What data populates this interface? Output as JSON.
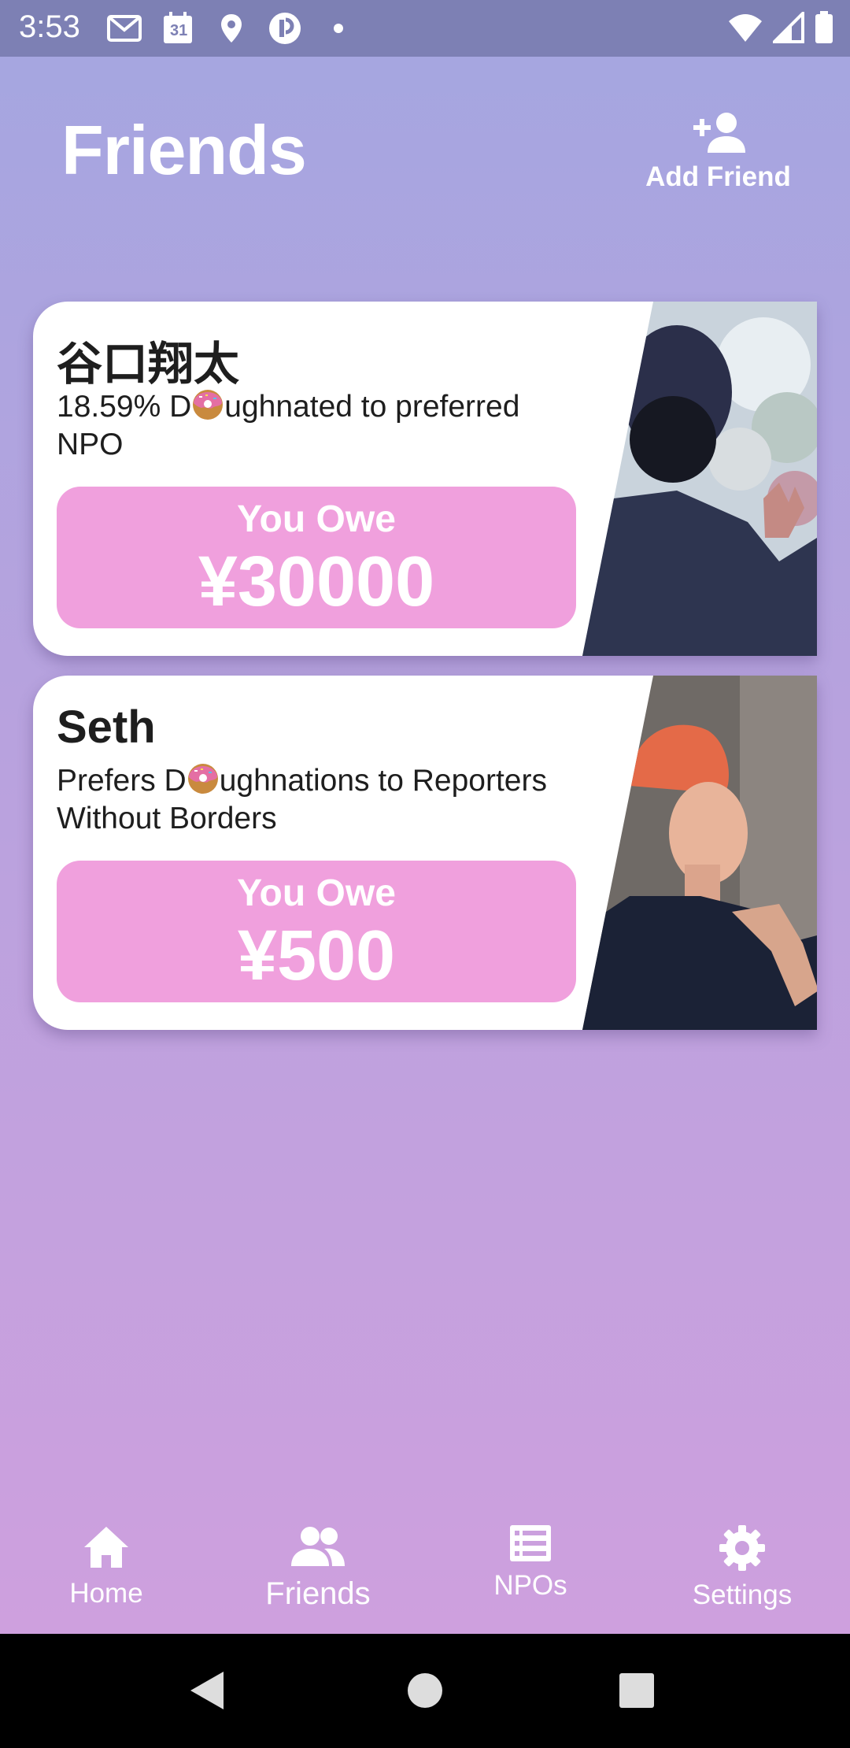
{
  "status_bar": {
    "time": "3:53",
    "calendar_day": "31",
    "left_icons": [
      "gmail-icon",
      "calendar-icon",
      "location-icon",
      "app-icon",
      "dot-icon"
    ],
    "right_icons": [
      "wifi-icon",
      "signal-icon",
      "battery-icon"
    ]
  },
  "header": {
    "title": "Friends",
    "add_friend_label": "Add Friend"
  },
  "friends": [
    {
      "name": "谷口翔太",
      "desc_before": "18.59% D",
      "desc_after": "ughnated to preferred NPO",
      "owe_label": "You Owe",
      "owe_amount": "¥30000"
    },
    {
      "name": "Seth",
      "desc_before": "Prefers D",
      "desc_after": "ughnations to Reporters Without Borders",
      "owe_label": "You Owe",
      "owe_amount": "¥500"
    }
  ],
  "nav": {
    "items": [
      {
        "label": "Home",
        "icon": "home-icon",
        "active": false
      },
      {
        "label": "Friends",
        "icon": "friends-icon",
        "active": true
      },
      {
        "label": "NPOs",
        "icon": "list-icon",
        "active": false
      },
      {
        "label": "Settings",
        "icon": "gear-icon",
        "active": false
      }
    ]
  },
  "colors": {
    "owe_box": "#f0a0dd",
    "status_bar": "#7d80b4",
    "gradient_top": "#a4a6e0",
    "gradient_bottom": "#cea0de"
  }
}
